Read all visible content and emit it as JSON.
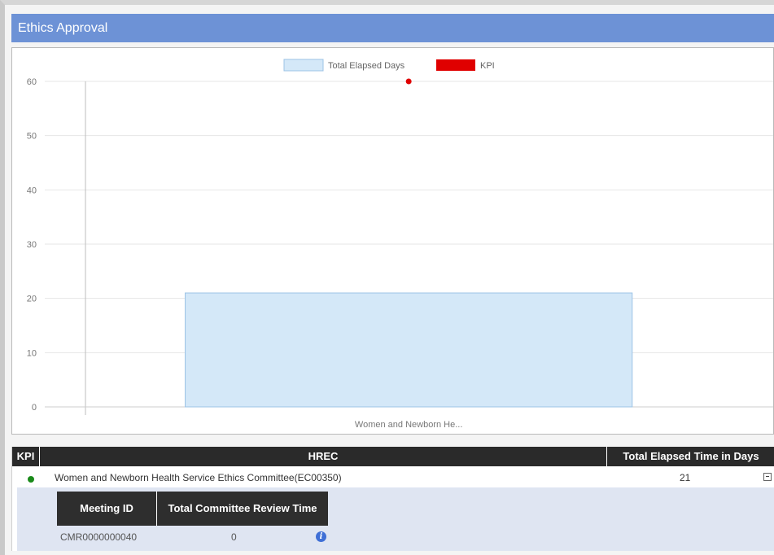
{
  "panel": {
    "title": "Ethics Approval"
  },
  "chart_data": {
    "type": "bar",
    "categories": [
      "Women and Newborn He..."
    ],
    "series": [
      {
        "name": "Total Elapsed Days",
        "values": [
          21
        ],
        "color": "#d4e8f8",
        "kind": "bar"
      },
      {
        "name": "KPI",
        "values": [
          60
        ],
        "color": "#e00000",
        "kind": "point"
      }
    ],
    "ylim": [
      0,
      60
    ],
    "yticks": [
      0,
      10,
      20,
      30,
      40,
      50,
      60
    ],
    "grid": true,
    "legend_position": "top-center"
  },
  "grid": {
    "columns": [
      "KPI",
      "HREC",
      "Total Elapsed Time in Days"
    ],
    "rows": [
      {
        "kpi_status": "green",
        "hrec": "Women and Newborn Health Service Ethics Committee(EC00350)",
        "total_elapsed": "21",
        "expanded": true,
        "detail": {
          "columns": [
            "Meeting ID",
            "Total Committee Review Time"
          ],
          "rows": [
            {
              "meeting_id": "CMR0000000040",
              "review_time": "0",
              "info_icon": "info-icon"
            }
          ]
        }
      }
    ]
  }
}
